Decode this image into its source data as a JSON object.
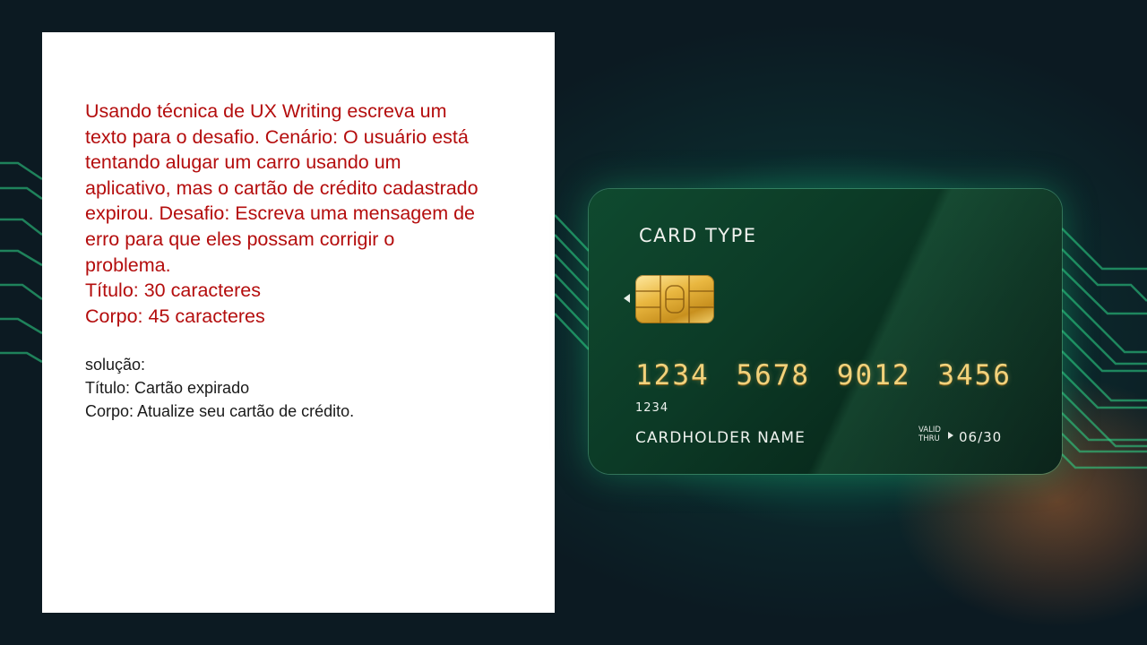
{
  "prompt": {
    "paragraph": "Usando técnica de UX Writing escreva um texto para o desafio. Cenário: O usuário está tentando alugar um carro usando um aplicativo, mas o cartão de crédito cadastrado expirou. Desafio: Escreva uma mensagem de erro para que eles possam corrigir o problema.",
    "title_limit": "Título: 30 caracteres",
    "body_limit": "Corpo: 45 caracteres"
  },
  "solution": {
    "heading": "solução:",
    "title": "Título: Cartão expirado",
    "body": "Corpo: Atualize seu cartão de crédito."
  },
  "card": {
    "type_label": "CARD TYPE",
    "number_groups": [
      "1234",
      "5678",
      "9012",
      "3456"
    ],
    "small_digits": "1234",
    "holder": "CARDHOLDER NAME",
    "valid_label_1": "VALID",
    "valid_label_2": "THRU",
    "expiry": "06/30"
  },
  "colors": {
    "prompt_text": "#b40d0d",
    "solution_text": "#1a1a1a",
    "card_number": "#f1d27c",
    "circuit": "#2fd88a"
  }
}
